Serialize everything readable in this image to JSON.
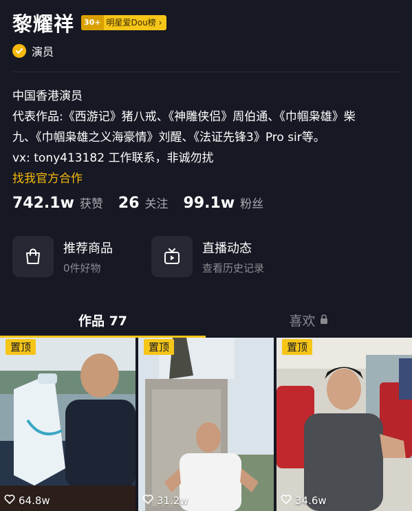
{
  "profile": {
    "name": "黎耀祥",
    "rank_badge_num": "30+",
    "rank_badge_text": "明星爱Dou榜",
    "rank_badge_arrow": "›",
    "verify_label": "演员"
  },
  "bio": {
    "line1": "中国香港演员",
    "line2": "代表作品:《西游记》猪八戒、《神雕侠侣》周伯通、《巾帼枭雄》柴",
    "line3": "九、《巾帼枭雄之义海豪情》刘醒、《法证先锋3》Pro sir等。",
    "line4": "vx: tony413182 工作联系，非诚勿扰",
    "link": "找我官方合作"
  },
  "stats": [
    {
      "num": "742.1w",
      "label": "获赞"
    },
    {
      "num": "26",
      "label": "关注"
    },
    {
      "num": "99.1w",
      "label": "粉丝"
    }
  ],
  "features": [
    {
      "title": "推荐商品",
      "sub": "0件好物",
      "icon": "shopping-bag-icon"
    },
    {
      "title": "直播动态",
      "sub": "查看历史记录",
      "icon": "tv-play-icon"
    }
  ],
  "tabs": {
    "works": "作品 77",
    "likes": "喜欢"
  },
  "videos": [
    {
      "pin": "置顶",
      "count": "64.8w"
    },
    {
      "pin": "置顶",
      "count": "31.2w"
    },
    {
      "pin": "置顶",
      "count": "34.6w"
    }
  ],
  "colors": {
    "background": "#161823",
    "accent": "#f5c518",
    "link": "#f5b90c",
    "muted": "#8a8b91"
  }
}
